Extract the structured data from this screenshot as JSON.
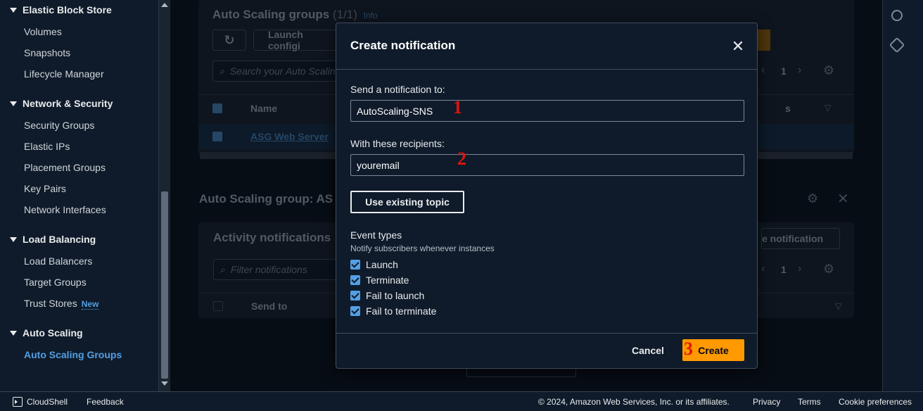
{
  "sidebar": {
    "sections": [
      {
        "title": "Elastic Block Store",
        "items": [
          "Volumes",
          "Snapshots",
          "Lifecycle Manager"
        ]
      },
      {
        "title": "Network & Security",
        "items": [
          "Security Groups",
          "Elastic IPs",
          "Placement Groups",
          "Key Pairs",
          "Network Interfaces"
        ]
      },
      {
        "title": "Load Balancing",
        "items": [
          "Load Balancers",
          "Target Groups",
          "Trust Stores"
        ]
      },
      {
        "title": "Auto Scaling",
        "items": [
          "Auto Scaling Groups"
        ]
      }
    ],
    "new_badge": "New",
    "active_item": "Auto Scaling Groups"
  },
  "background": {
    "asg_title": "Auto Scaling groups",
    "asg_count": "(1/1)",
    "info_link": "Info",
    "launch_btn": "Launch configi",
    "search_placeholder": "Search your Auto Scalin",
    "col_name": "Name",
    "col_partial": "s",
    "row_name": "ASG Web Server",
    "page_num": "1",
    "detail_title": "Auto Scaling group: AS",
    "activity_title": "Activity notifications",
    "create_partial": "e notification",
    "filter_placeholder": "Filter notifications",
    "col_send_to": "Send to",
    "page_num2": "1"
  },
  "modal": {
    "title": "Create notification",
    "send_label": "Send a notification to:",
    "send_value": "AutoScaling-SNS",
    "recipients_label": "With these recipients:",
    "recipients_value": "youremail",
    "use_existing_btn": "Use existing topic",
    "event_types_title": "Event types",
    "event_types_desc": "Notify subscribers whenever instances",
    "events": [
      "Launch",
      "Terminate",
      "Fail to launch",
      "Fail to terminate"
    ],
    "cancel_btn": "Cancel",
    "create_btn": "Create"
  },
  "annotations": [
    "1",
    "2",
    "3"
  ],
  "footer": {
    "cloudshell": "CloudShell",
    "feedback": "Feedback",
    "copyright": "© 2024, Amazon Web Services, Inc. or its affiliates.",
    "privacy": "Privacy",
    "terms": "Terms",
    "cookie": "Cookie preferences"
  },
  "colors": {
    "accent": "#539fe5",
    "primary_button": "#ff9900",
    "annotation": "#e0140b"
  }
}
